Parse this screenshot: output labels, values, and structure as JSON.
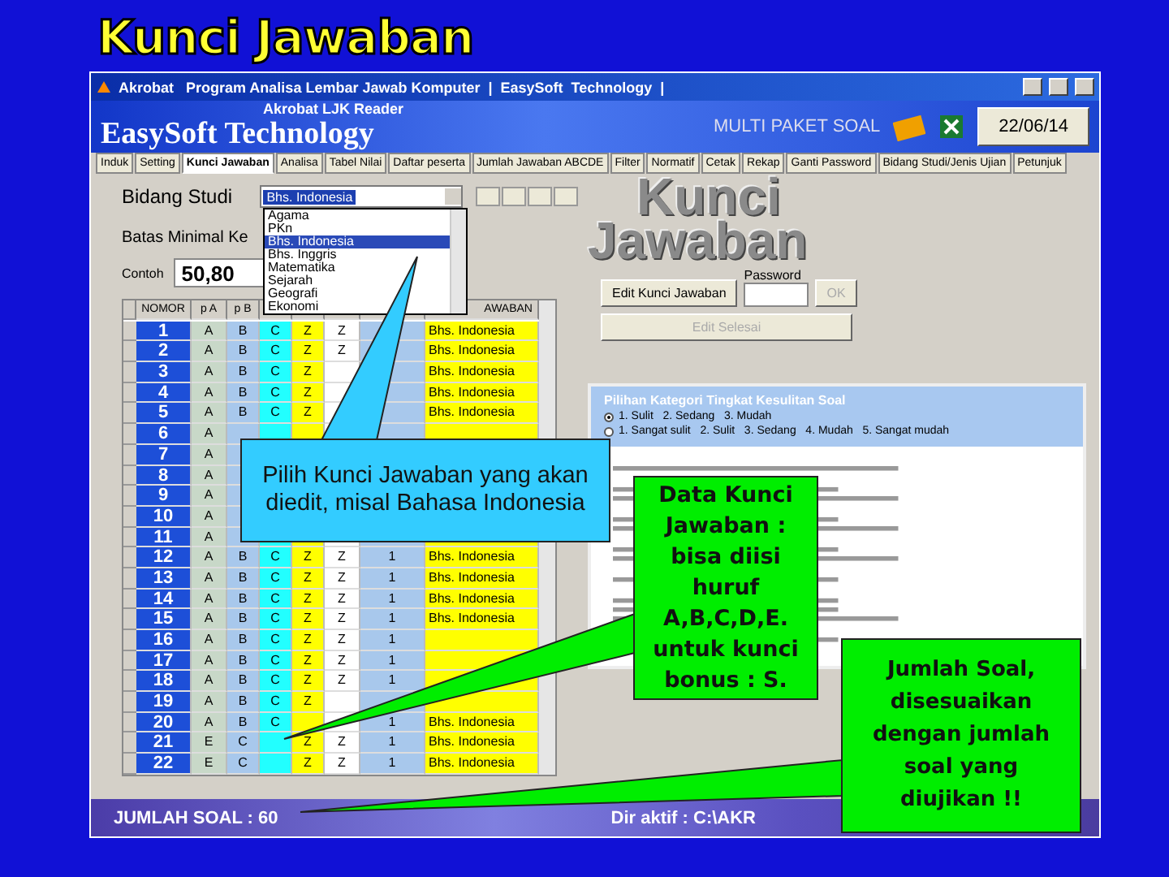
{
  "slide_title": "Kunci Jawaban",
  "window": {
    "title": "Akrobat   Program Analisa Lembar Jawab Komputer  |  EasySoft  Technology  |"
  },
  "header": {
    "subtitle": "Akrobat LJK Reader",
    "brand": "EasySoft Technology",
    "mode": "MULTI PAKET SOAL",
    "date": "22/06/14"
  },
  "tabs": [
    {
      "label": "Induk",
      "selected": false
    },
    {
      "label": "Setting",
      "selected": false
    },
    {
      "label": "Kunci Jawaban",
      "selected": true
    },
    {
      "label": "Analisa",
      "selected": false
    },
    {
      "label": "Tabel Nilai",
      "selected": false
    },
    {
      "label": "Daftar peserta",
      "selected": false
    },
    {
      "label": "Jumlah Jawaban ABCDE",
      "selected": false
    },
    {
      "label": "Filter",
      "selected": false
    },
    {
      "label": "Normatif",
      "selected": false
    },
    {
      "label": "Cetak",
      "selected": false
    },
    {
      "label": "Rekap",
      "selected": false
    },
    {
      "label": "Ganti Password",
      "selected": false
    },
    {
      "label": "Bidang Studi/Jenis Ujian",
      "selected": false
    },
    {
      "label": "Petunjuk",
      "selected": false
    }
  ],
  "bidang_studi": {
    "label": "Bidang Studi",
    "value": "Bhs. Indonesia",
    "options": [
      {
        "label": "Agama",
        "selected": false
      },
      {
        "label": "PKn",
        "selected": false
      },
      {
        "label": "Bhs. Indonesia",
        "selected": true
      },
      {
        "label": "Bhs. Inggris",
        "selected": false
      },
      {
        "label": "Matematika",
        "selected": false
      },
      {
        "label": "Sejarah",
        "selected": false
      },
      {
        "label": "Geografi",
        "selected": false
      },
      {
        "label": "Ekonomi",
        "selected": false
      }
    ]
  },
  "batas": {
    "label": "Batas Minimal Ke",
    "example_label": "Contoh",
    "value": "50,80"
  },
  "grid": {
    "columns": [
      {
        "label": "NOMOR"
      },
      {
        "label": "p A"
      },
      {
        "label": "p B"
      },
      {},
      {},
      {},
      {},
      {
        "label": "AWABAN"
      }
    ],
    "rows": [
      [
        "1",
        "A",
        "B",
        "C",
        "Z",
        "Z",
        null,
        "Bhs. Indonesia"
      ],
      [
        "2",
        "A",
        "B",
        "C",
        "Z",
        "Z",
        null,
        "Bhs. Indonesia"
      ],
      [
        "3",
        "A",
        "B",
        "C",
        "Z",
        null,
        null,
        "Bhs. Indonesia"
      ],
      [
        "4",
        "A",
        "B",
        "C",
        "Z",
        null,
        null,
        "Bhs. Indonesia"
      ],
      [
        "5",
        "A",
        "B",
        "C",
        "Z",
        null,
        null,
        "Bhs. Indonesia"
      ],
      [
        "6",
        "A"
      ],
      [
        "7",
        "A"
      ],
      [
        "8",
        "A"
      ],
      [
        "9",
        "A"
      ],
      [
        "10",
        "A"
      ],
      [
        "11",
        "A"
      ],
      [
        "12",
        "A",
        "B",
        "C",
        "Z",
        "Z",
        "1",
        "Bhs. Indonesia"
      ],
      [
        "13",
        "A",
        "B",
        "C",
        "Z",
        "Z",
        "1",
        "Bhs. Indonesia"
      ],
      [
        "14",
        "A",
        "B",
        "C",
        "Z",
        "Z",
        "1",
        "Bhs. Indonesia"
      ],
      [
        "15",
        "A",
        "B",
        "C",
        "Z",
        "Z",
        "1",
        "Bhs. Indonesia"
      ],
      [
        "16",
        "A",
        "B",
        "C",
        "Z",
        "Z",
        "1",
        null
      ],
      [
        "17",
        "A",
        "B",
        "C",
        "Z",
        "Z",
        "1",
        null
      ],
      [
        "18",
        "A",
        "B",
        "C",
        "Z",
        "Z",
        "1",
        null
      ],
      [
        "19",
        "A",
        "B",
        "C",
        "Z",
        null,
        null,
        null
      ],
      [
        "20",
        "A",
        "B",
        "C",
        null,
        null,
        "1",
        "Bhs. Indonesia"
      ],
      [
        "21",
        "E",
        "C",
        null,
        "Z",
        "Z",
        "1",
        "Bhs. Indonesia"
      ],
      [
        "22",
        "E",
        "C",
        null,
        "Z",
        "Z",
        "1",
        "Bhs. Indonesia"
      ]
    ]
  },
  "logo": {
    "line1": "Kunci",
    "line2": "Jawaban"
  },
  "edit_button": "Edit Kunci Jawaban",
  "password": {
    "label": "Password",
    "ok": "OK"
  },
  "done_button": {
    "label": "Edit Selesai",
    "disabled": true
  },
  "difficulty": {
    "title": "Pilihan Kategori Tingkat Kesulitan Soal",
    "options": [
      {
        "label": "1. Sulit   2. Sedang   3. Mudah",
        "selected": true
      },
      {
        "label": "1. Sangat sulit   2. Sulit   3. Sedang   4. Mudah   5. Sangat mudah",
        "selected": false
      }
    ]
  },
  "status_bar": {
    "count": "JUMLAH SOAL : 60",
    "dir": "Dir aktif : C:\\AKR"
  },
  "callouts": [
    {
      "kind": "blue",
      "text": "Pilih Kunci Jawaban yang akan diedit, misal Bahasa Indonesia"
    },
    {
      "kind": "green",
      "text": "Data Kunci Jawaban : bisa diisi huruf A,B,C,D,E. untuk kunci bonus : S."
    },
    {
      "kind": "green2",
      "text": "Jumlah Soal, disesuaikan dengan jumlah soal yang diujikan !!"
    }
  ]
}
